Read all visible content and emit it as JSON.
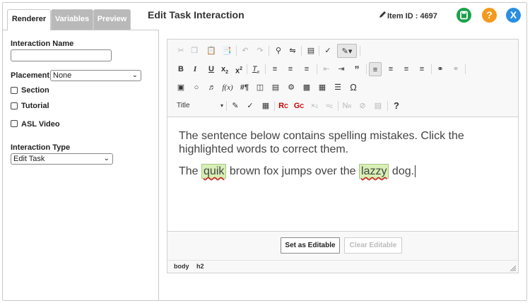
{
  "tabs": [
    "Renderer",
    "Variables",
    "Preview"
  ],
  "header": {
    "title": "Edit Task Interaction",
    "item_id": "Item ID : 4697"
  },
  "left": {
    "interaction_name_label": "Interaction Name",
    "interaction_name_value": "",
    "placement_label": "Placement",
    "placement_value": "None",
    "section_label": "Section",
    "tutorial_label": "Tutorial",
    "asl_label": "ASL Video",
    "interaction_type_label": "Interaction Type",
    "interaction_type_value": "Edit Task"
  },
  "editor": {
    "style_combo": "Title",
    "paragraph1": "The sentence below contains spelling mistakes. Click the highlighted words to correct them.",
    "p2_part1": "The ",
    "p2_word1": "quik",
    "p2_part2": " brown fox jumps over the ",
    "p2_word2": "lazzy",
    "p2_part3": " dog.",
    "set_editable": "Set as Editable",
    "clear_editable": "Clear Editable",
    "path": [
      "body",
      "h2"
    ]
  },
  "colors": {
    "save": "#1aa14a",
    "help": "#f39a1e",
    "close": "#2a8fe0",
    "highlight": "#d8efb5"
  },
  "icons": {
    "save": "save-icon",
    "help": "help-icon",
    "close": "close-icon",
    "edit": "pencil-icon"
  }
}
